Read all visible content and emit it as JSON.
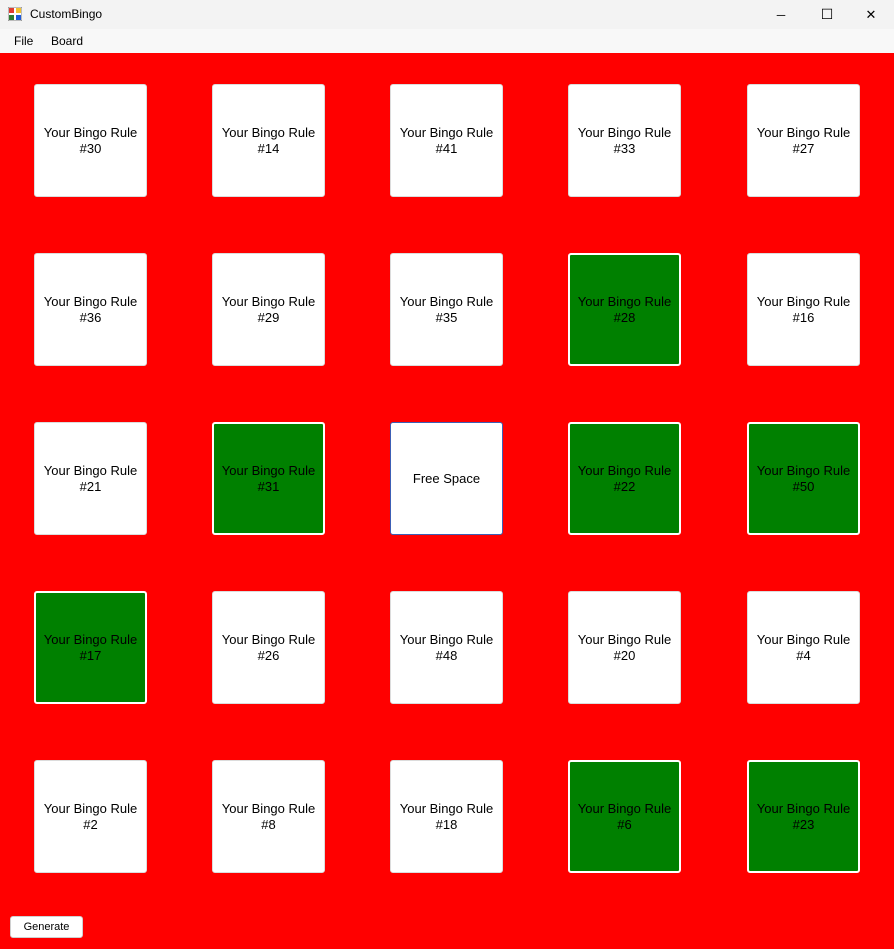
{
  "window": {
    "title": "CustomBingo",
    "minimize_glyph": "─",
    "maximize_glyph": "☐",
    "close_glyph": "✕"
  },
  "menu": {
    "items": [
      {
        "label": "File"
      },
      {
        "label": "Board"
      }
    ]
  },
  "colors": {
    "board_background": "#ff0000",
    "marked_cell": "#008000",
    "unmarked_cell": "#ffffff"
  },
  "board": {
    "cells": [
      {
        "label": "Your Bingo Rule\n#30",
        "marked": false
      },
      {
        "label": "Your Bingo Rule\n#14",
        "marked": false
      },
      {
        "label": "Your Bingo Rule\n#41",
        "marked": false
      },
      {
        "label": "Your Bingo Rule\n#33",
        "marked": false
      },
      {
        "label": "Your Bingo Rule\n#27",
        "marked": false
      },
      {
        "label": "Your Bingo Rule\n#36",
        "marked": false
      },
      {
        "label": "Your Bingo Rule\n#29",
        "marked": false
      },
      {
        "label": "Your Bingo Rule\n#35",
        "marked": false
      },
      {
        "label": "Your Bingo Rule\n#28",
        "marked": true
      },
      {
        "label": "Your Bingo Rule\n#16",
        "marked": false
      },
      {
        "label": "Your Bingo Rule\n#21",
        "marked": false
      },
      {
        "label": "Your Bingo Rule\n#31",
        "marked": true
      },
      {
        "label": "Free Space",
        "marked": false,
        "free": true
      },
      {
        "label": "Your Bingo Rule\n#22",
        "marked": true
      },
      {
        "label": "Your Bingo Rule\n#50",
        "marked": true
      },
      {
        "label": "Your Bingo Rule\n#17",
        "marked": true
      },
      {
        "label": "Your Bingo Rule\n#26",
        "marked": false
      },
      {
        "label": "Your Bingo Rule\n#48",
        "marked": false
      },
      {
        "label": "Your Bingo Rule\n#20",
        "marked": false
      },
      {
        "label": "Your Bingo Rule\n#4",
        "marked": false
      },
      {
        "label": "Your Bingo Rule\n#2",
        "marked": false
      },
      {
        "label": "Your Bingo Rule\n#8",
        "marked": false
      },
      {
        "label": "Your Bingo Rule\n#18",
        "marked": false
      },
      {
        "label": "Your Bingo Rule\n#6",
        "marked": true
      },
      {
        "label": "Your Bingo Rule\n#23",
        "marked": true
      }
    ]
  },
  "footer": {
    "generate_label": "Generate"
  }
}
